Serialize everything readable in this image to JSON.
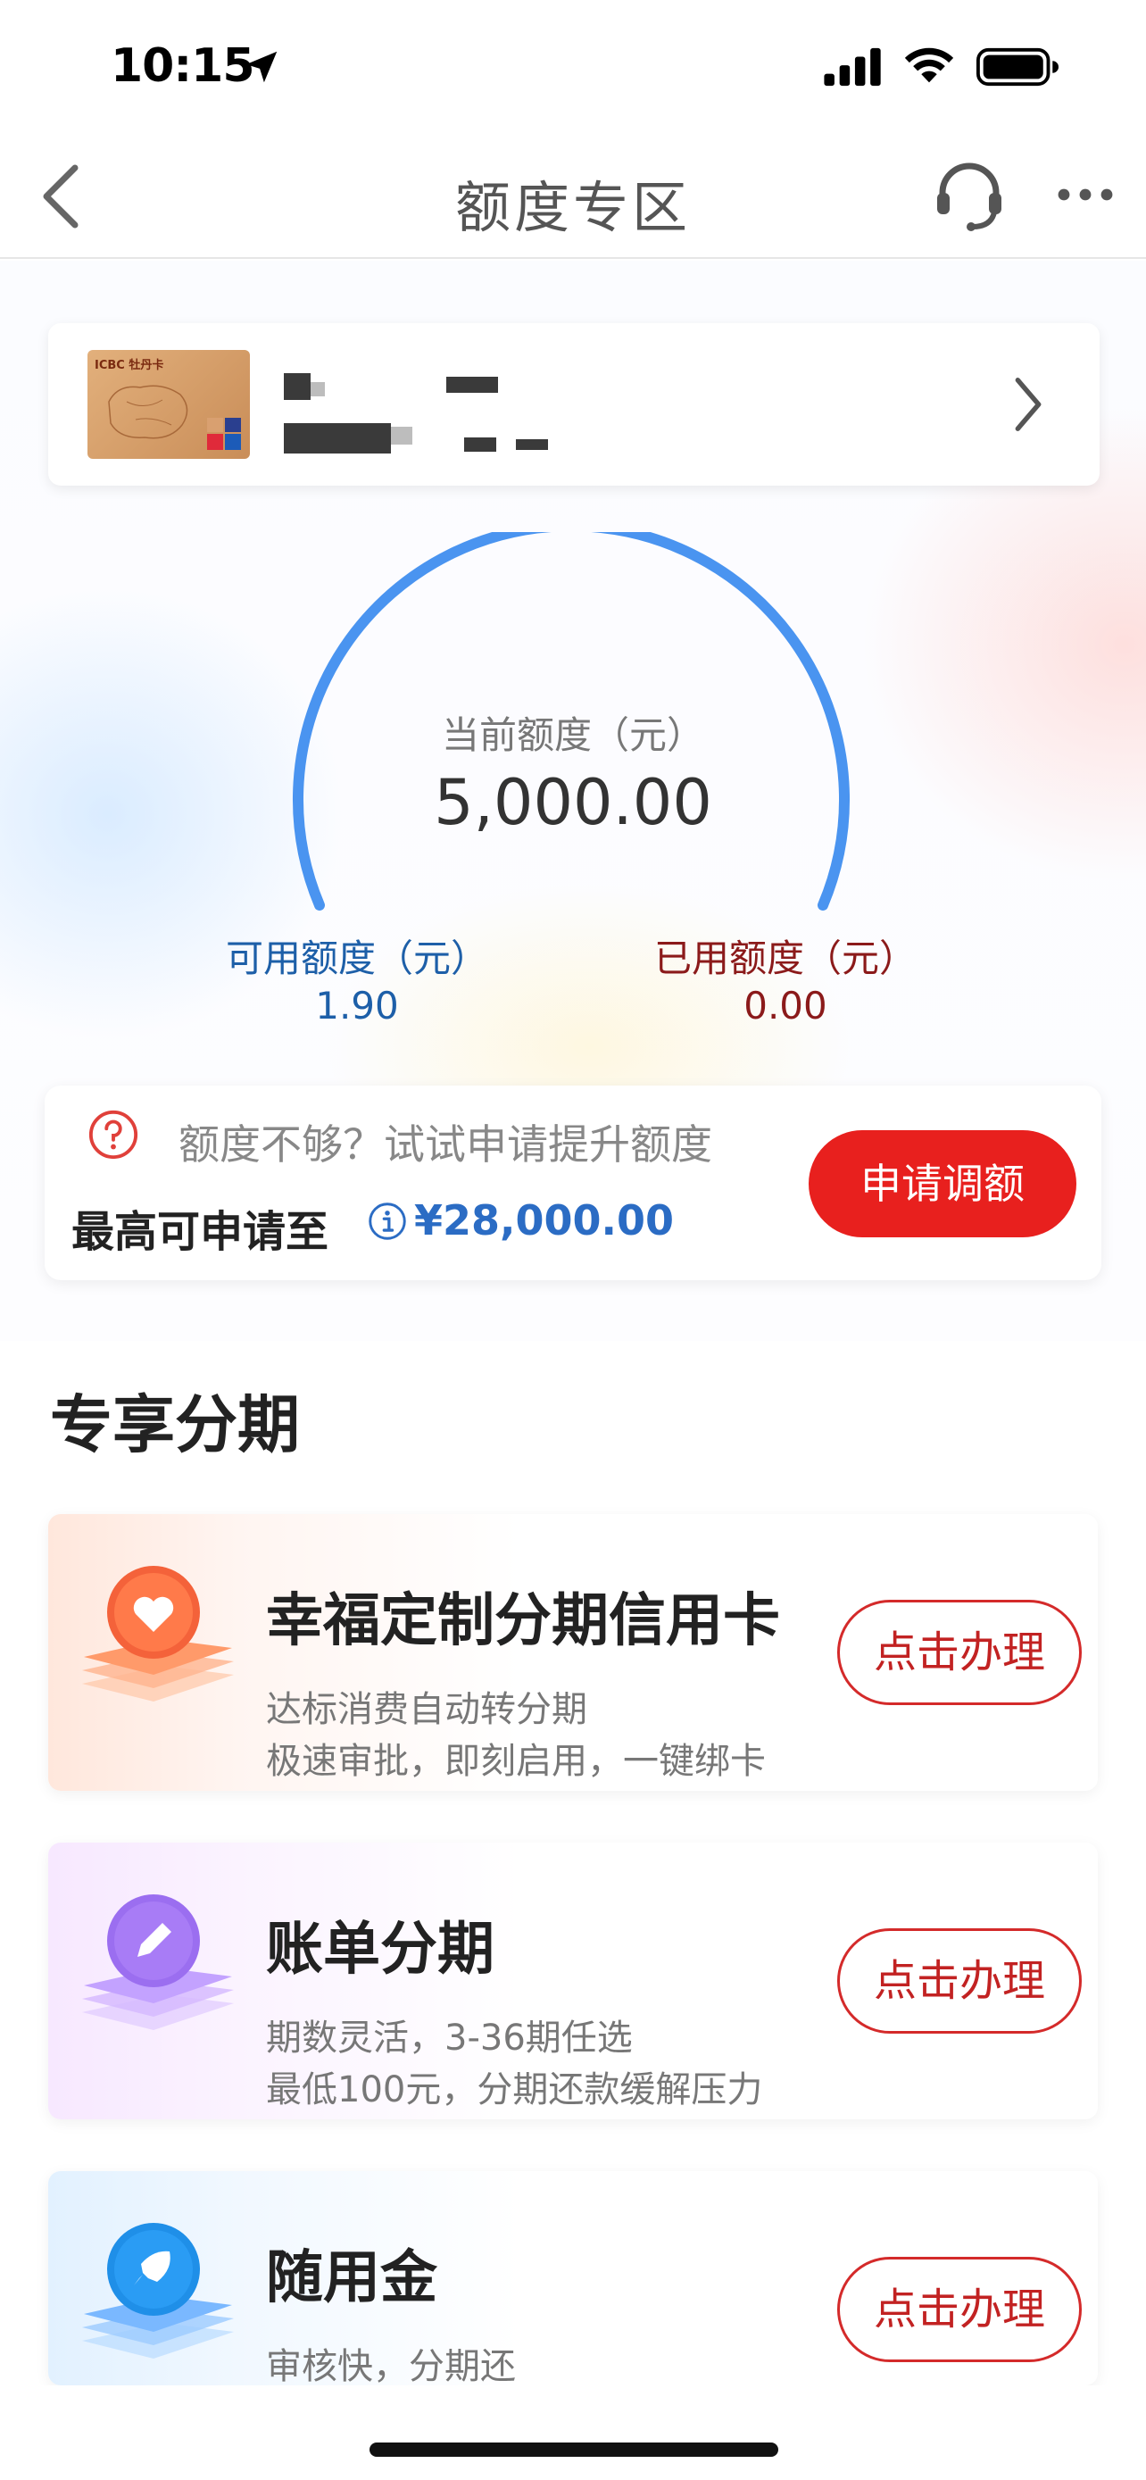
{
  "status_bar": {
    "time": "10:15",
    "icons": [
      "location-arrow-icon",
      "signal-icon",
      "wifi-icon",
      "battery-icon"
    ]
  },
  "nav": {
    "title": "额度专区",
    "back_icon": "chevron-left-icon",
    "service_icon": "headset-icon",
    "more_icon": "more-icon"
  },
  "card": {
    "thumb_brand": "ICBC 牡丹卡",
    "name_masked": true,
    "chevron_icon": "chevron-right-icon"
  },
  "gauge": {
    "label": "当前额度（元）",
    "value": "5,000.00",
    "accent_color": "#4a94f0"
  },
  "available": {
    "label": "可用额度（元）",
    "value": "1.90"
  },
  "used": {
    "label": "已用额度（元）",
    "value": "0.00"
  },
  "raise": {
    "prompt": "额度不够？试试申请提升额度",
    "max_label": "最高可申请至",
    "max_value": "¥28,000.00",
    "button": "申请调额"
  },
  "section": {
    "title": "专享分期"
  },
  "promos": [
    {
      "title": "幸福定制分期信用卡",
      "desc1": "达标消费自动转分期",
      "desc2": "极速审批，即刻启用，一键绑卡",
      "button": "点击办理",
      "icon": "heart-icon",
      "color": "#f4623a"
    },
    {
      "title": "账单分期",
      "desc1": "期数灵活，3-36期任选",
      "desc2": "最低100元，分期还款缓解压力",
      "button": "点击办理",
      "icon": "pencil-icon",
      "color": "#9b6ef0"
    },
    {
      "title": "随用金",
      "desc1": "审核快，分期还",
      "button": "点击办理",
      "icon": "rocket-icon",
      "color": "#1f8fe8"
    }
  ]
}
